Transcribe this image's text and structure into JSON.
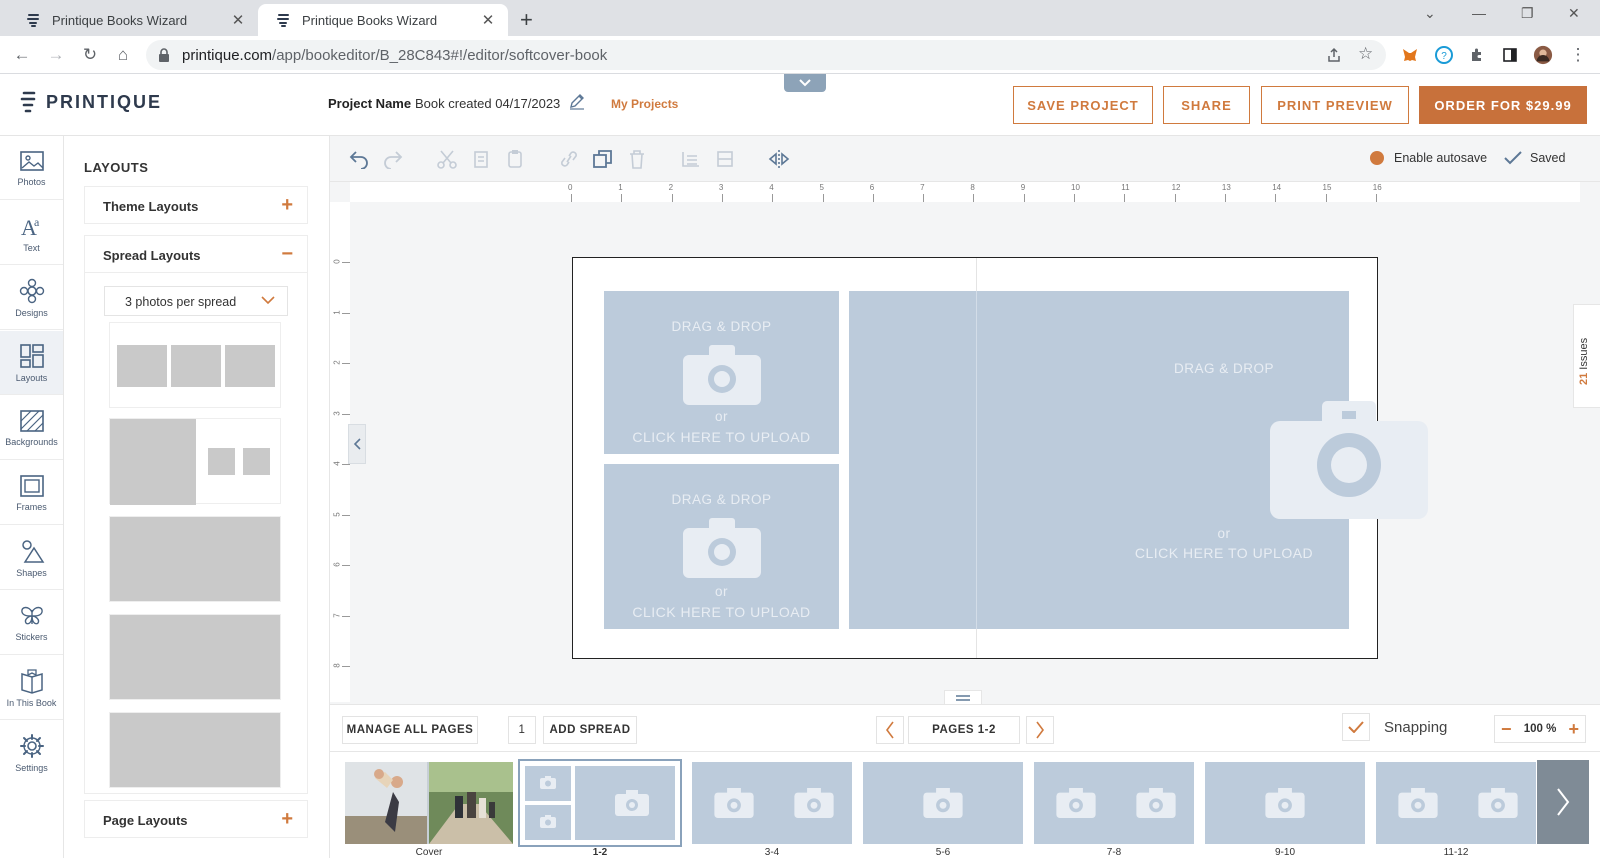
{
  "browser": {
    "tabs": [
      {
        "title": "Printique Books Wizard",
        "active": false
      },
      {
        "title": "Printique Books Wizard",
        "active": true
      }
    ],
    "url": "printique.com",
    "url_path": "/app/bookeditor/B_28C843#!/editor/softcover-book"
  },
  "header": {
    "logo_text": "PRINTIQUE",
    "project_label": "Project Name",
    "project_name": "Book created 04/17/2023",
    "my_projects": "My Projects",
    "save_project": "SAVE PROJECT",
    "share": "SHARE",
    "print_preview": "PRINT PREVIEW",
    "order": "ORDER FOR $29.99"
  },
  "rail": [
    {
      "label": "Photos",
      "icon": "photos-icon"
    },
    {
      "label": "Text",
      "icon": "text-icon"
    },
    {
      "label": "Designs",
      "icon": "designs-icon"
    },
    {
      "label": "Layouts",
      "icon": "layouts-icon",
      "active": true
    },
    {
      "label": "Backgrounds",
      "icon": "backgrounds-icon"
    },
    {
      "label": "Frames",
      "icon": "frames-icon"
    },
    {
      "label": "Shapes",
      "icon": "shapes-icon"
    },
    {
      "label": "Stickers",
      "icon": "stickers-icon"
    },
    {
      "label": "In This Book",
      "icon": "book-icon"
    },
    {
      "label": "Settings",
      "icon": "settings-icon"
    }
  ],
  "panel": {
    "title": "LAYOUTS",
    "theme_layouts": "Theme Layouts",
    "spread_layouts": "Spread Layouts",
    "page_layouts": "Page Layouts",
    "dropdown_value": "3 photos per spread",
    "plus": "+",
    "minus": "−"
  },
  "toolbar": {
    "enable_autosave": "Enable autosave",
    "saved": "Saved",
    "issues_count": "21",
    "issues_label": "Issues"
  },
  "ruler": {
    "h": [
      "0",
      "1",
      "2",
      "3",
      "4",
      "5",
      "6",
      "7",
      "8",
      "9",
      "10",
      "11",
      "12",
      "13",
      "14",
      "15",
      "16"
    ],
    "v": [
      "0",
      "1",
      "2",
      "3",
      "4",
      "5",
      "6",
      "7",
      "8"
    ]
  },
  "slots": {
    "drag_drop": "DRAG & DROP",
    "or": "or",
    "upload": "CLICK HERE TO UPLOAD"
  },
  "pagebar": {
    "manage": "MANAGE ALL PAGES",
    "count": "1",
    "add_spread": "ADD SPREAD",
    "pages": "PAGES 1-2",
    "snapping": "Snapping",
    "zoom": "100 %",
    "zoom_minus": "−",
    "zoom_plus": "+"
  },
  "filmstrip": [
    {
      "label": "Cover"
    },
    {
      "label": "1-2",
      "selected": true
    },
    {
      "label": "3-4"
    },
    {
      "label": "5-6"
    },
    {
      "label": "7-8"
    },
    {
      "label": "9-10"
    },
    {
      "label": "11-12"
    }
  ],
  "colors": {
    "accent": "#d07a3e",
    "slot": "#bccbdb",
    "navy": "#2e3a4d"
  }
}
